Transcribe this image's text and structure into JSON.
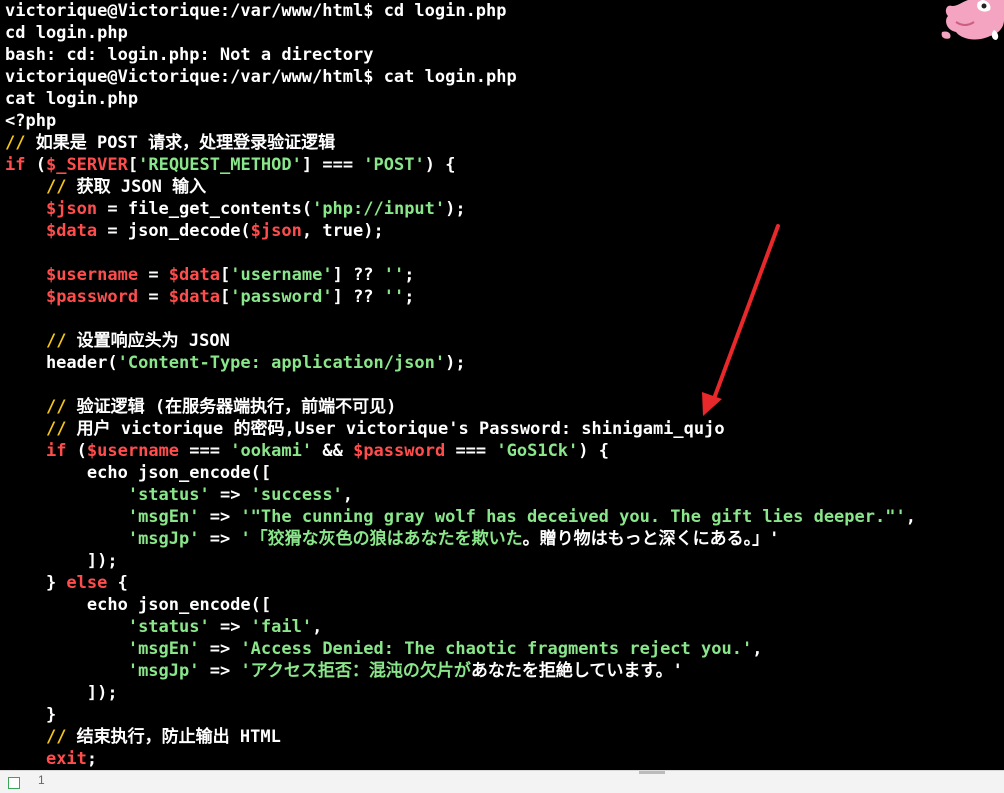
{
  "terminal": {
    "lines": [
      [
        {
          "t": "victorique@Victorique:/var/www/html$ cd login.php",
          "c": "w"
        }
      ],
      [
        {
          "t": "cd login.php",
          "c": "w"
        }
      ],
      [
        {
          "t": "bash: cd: login.php: Not a directory",
          "c": "w"
        }
      ],
      [
        {
          "t": "victorique@Victorique:/var/www/html$ cat login.php",
          "c": "w"
        }
      ],
      [
        {
          "t": "cat login.php",
          "c": "w"
        }
      ],
      [
        {
          "t": "<?php",
          "c": "w"
        }
      ],
      [
        {
          "t": "//",
          "c": "y"
        },
        {
          "t": " 如果是 POST 请求，处理登录验证逻辑",
          "c": "w"
        }
      ],
      [
        {
          "t": "if",
          "c": "r"
        },
        {
          "t": " (",
          "c": "w"
        },
        {
          "t": "$_SERVER",
          "c": "r"
        },
        {
          "t": "[",
          "c": "w"
        },
        {
          "t": "'REQUEST_METHOD'",
          "c": "g"
        },
        {
          "t": "] === ",
          "c": "w"
        },
        {
          "t": "'POST'",
          "c": "g"
        },
        {
          "t": ") {",
          "c": "w"
        }
      ],
      [
        {
          "t": "    ",
          "c": "w"
        },
        {
          "t": "//",
          "c": "y"
        },
        {
          "t": " 获取 JSON 输入",
          "c": "w"
        }
      ],
      [
        {
          "t": "    ",
          "c": "w"
        },
        {
          "t": "$json",
          "c": "r"
        },
        {
          "t": " = file_get_contents(",
          "c": "w"
        },
        {
          "t": "'php://input'",
          "c": "g"
        },
        {
          "t": ");",
          "c": "w"
        }
      ],
      [
        {
          "t": "    ",
          "c": "w"
        },
        {
          "t": "$data",
          "c": "r"
        },
        {
          "t": " = json_decode(",
          "c": "w"
        },
        {
          "t": "$json",
          "c": "r"
        },
        {
          "t": ", true);",
          "c": "w"
        }
      ],
      [],
      [
        {
          "t": "    ",
          "c": "w"
        },
        {
          "t": "$username",
          "c": "r"
        },
        {
          "t": " = ",
          "c": "w"
        },
        {
          "t": "$data",
          "c": "r"
        },
        {
          "t": "[",
          "c": "w"
        },
        {
          "t": "'username'",
          "c": "g"
        },
        {
          "t": "] ?? ",
          "c": "w"
        },
        {
          "t": "''",
          "c": "g"
        },
        {
          "t": ";",
          "c": "w"
        }
      ],
      [
        {
          "t": "    ",
          "c": "w"
        },
        {
          "t": "$password",
          "c": "r"
        },
        {
          "t": " = ",
          "c": "w"
        },
        {
          "t": "$data",
          "c": "r"
        },
        {
          "t": "[",
          "c": "w"
        },
        {
          "t": "'password'",
          "c": "g"
        },
        {
          "t": "] ?? ",
          "c": "w"
        },
        {
          "t": "''",
          "c": "g"
        },
        {
          "t": ";",
          "c": "w"
        }
      ],
      [],
      [
        {
          "t": "    ",
          "c": "w"
        },
        {
          "t": "//",
          "c": "y"
        },
        {
          "t": " 设置响应头为 JSON",
          "c": "w"
        }
      ],
      [
        {
          "t": "    header(",
          "c": "w"
        },
        {
          "t": "'Content-Type: application/json'",
          "c": "g"
        },
        {
          "t": ");",
          "c": "w"
        }
      ],
      [],
      [
        {
          "t": "    ",
          "c": "w"
        },
        {
          "t": "//",
          "c": "y"
        },
        {
          "t": " 验证逻辑 (在服务器端执行，前端不可见)",
          "c": "w"
        }
      ],
      [
        {
          "t": "    ",
          "c": "w"
        },
        {
          "t": "//",
          "c": "y"
        },
        {
          "t": " 用户 victorique 的密码,User victorique's Password: shinigami_qujo",
          "c": "w"
        }
      ],
      [
        {
          "t": "    ",
          "c": "w"
        },
        {
          "t": "if",
          "c": "r"
        },
        {
          "t": " (",
          "c": "w"
        },
        {
          "t": "$username",
          "c": "r"
        },
        {
          "t": " === ",
          "c": "w"
        },
        {
          "t": "'ookami'",
          "c": "g"
        },
        {
          "t": " && ",
          "c": "w"
        },
        {
          "t": "$password",
          "c": "r"
        },
        {
          "t": " === ",
          "c": "w"
        },
        {
          "t": "'GoS1Ck'",
          "c": "g"
        },
        {
          "t": ") {",
          "c": "w"
        }
      ],
      [
        {
          "t": "        echo json_encode([",
          "c": "w"
        }
      ],
      [
        {
          "t": "            ",
          "c": "w"
        },
        {
          "t": "'status'",
          "c": "g"
        },
        {
          "t": " => ",
          "c": "w"
        },
        {
          "t": "'success'",
          "c": "g"
        },
        {
          "t": ",",
          "c": "w"
        }
      ],
      [
        {
          "t": "            ",
          "c": "w"
        },
        {
          "t": "'msgEn'",
          "c": "g"
        },
        {
          "t": " => ",
          "c": "w"
        },
        {
          "t": "'\"The cunning gray wolf has deceived you. The gift lies deeper.\"'",
          "c": "g"
        },
        {
          "t": ",",
          "c": "w"
        }
      ],
      [
        {
          "t": "            ",
          "c": "w"
        },
        {
          "t": "'msgJp'",
          "c": "g"
        },
        {
          "t": " => ",
          "c": "w"
        },
        {
          "t": "'「狡猾な灰色の狼はあなたを欺いた",
          "c": "g"
        },
        {
          "t": "。贈り物はもっと深くにある。」'",
          "c": "w"
        }
      ],
      [
        {
          "t": "        ]);",
          "c": "w"
        }
      ],
      [
        {
          "t": "    } ",
          "c": "w"
        },
        {
          "t": "else",
          "c": "r"
        },
        {
          "t": " {",
          "c": "w"
        }
      ],
      [
        {
          "t": "        echo json_encode([",
          "c": "w"
        }
      ],
      [
        {
          "t": "            ",
          "c": "w"
        },
        {
          "t": "'status'",
          "c": "g"
        },
        {
          "t": " => ",
          "c": "w"
        },
        {
          "t": "'fail'",
          "c": "g"
        },
        {
          "t": ",",
          "c": "w"
        }
      ],
      [
        {
          "t": "            ",
          "c": "w"
        },
        {
          "t": "'msgEn'",
          "c": "g"
        },
        {
          "t": " => ",
          "c": "w"
        },
        {
          "t": "'Access Denied: The chaotic fragments reject you.'",
          "c": "g"
        },
        {
          "t": ",",
          "c": "w"
        }
      ],
      [
        {
          "t": "            ",
          "c": "w"
        },
        {
          "t": "'msgJp'",
          "c": "g"
        },
        {
          "t": " => ",
          "c": "w"
        },
        {
          "t": "'アクセス拒否：混沌の欠片が",
          "c": "g"
        },
        {
          "t": "あなたを拒絶しています。'",
          "c": "w"
        }
      ],
      [
        {
          "t": "        ]);",
          "c": "w"
        }
      ],
      [
        {
          "t": "    }",
          "c": "w"
        }
      ],
      [
        {
          "t": "    ",
          "c": "w"
        },
        {
          "t": "//",
          "c": "y"
        },
        {
          "t": " 结束执行，防止输出 HTML",
          "c": "w"
        }
      ],
      [
        {
          "t": "    ",
          "c": "w"
        },
        {
          "t": "exit",
          "c": "r"
        },
        {
          "t": ";",
          "c": "w"
        }
      ]
    ]
  },
  "colors": {
    "background": "#000000",
    "text": "#ffffff",
    "comment_slash": "#f5c518",
    "variable": "#ff4d4d",
    "string": "#8ae68a",
    "annotation_arrow": "#e8282a"
  },
  "statusbar": {
    "line_number": "1"
  },
  "icons": {
    "mascot": "pink-creature-icon",
    "statusbar": "file-icon"
  }
}
